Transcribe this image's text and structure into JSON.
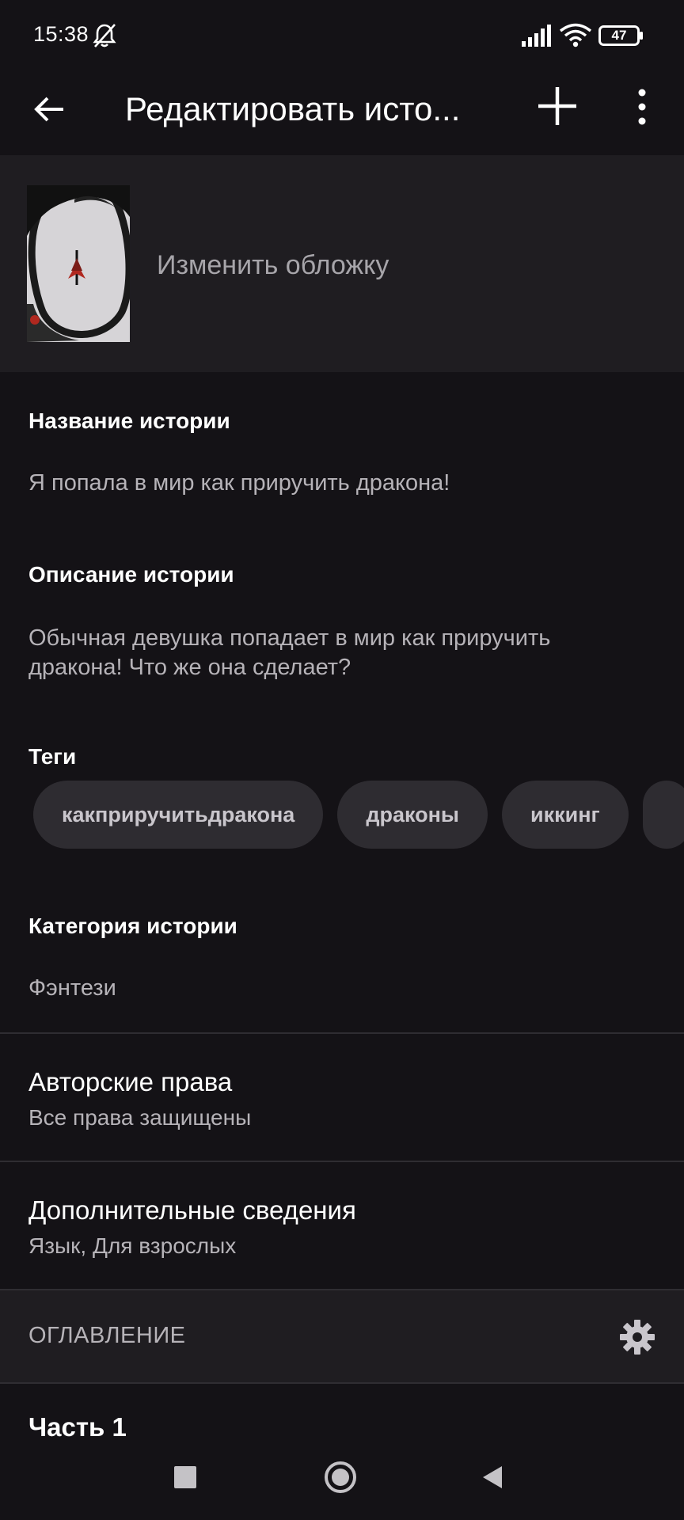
{
  "status": {
    "time": "15:38",
    "battery": "47"
  },
  "app_bar": {
    "title": "Редактировать исто..."
  },
  "cover": {
    "label": "Изменить обложку"
  },
  "story_title": {
    "label": "Название истории",
    "value": "Я попала в мир как приручить дракона!"
  },
  "story_description": {
    "label": "Описание истории",
    "value_line1": "Обычная девушка попадает в мир как приручить",
    "value_line2": "дракона! Что же она сделает?"
  },
  "tags": {
    "label": "Теги",
    "items": [
      "какприручитьдракона",
      "драконы",
      "иккинг"
    ]
  },
  "category": {
    "label": "Категория истории",
    "value": "Фэнтези"
  },
  "copyright": {
    "title": "Авторские права",
    "value": "Все права защищены"
  },
  "additional": {
    "title": "Дополнительные сведения",
    "value": "Язык, Для взрослых"
  },
  "toc": {
    "label": "ОГЛАВЛЕНИЕ"
  },
  "chapters": [
    {
      "title": "Часть 1"
    }
  ]
}
